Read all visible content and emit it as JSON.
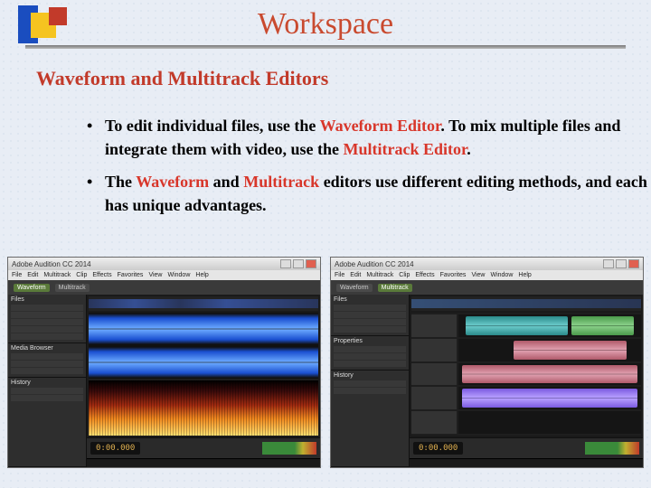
{
  "title": "Workspace",
  "subtitle": "Waveform and Multitrack Editors",
  "bullets": {
    "b1": {
      "pre": "To edit individual files, use the ",
      "em1": "Waveform Editor",
      "mid": ". To mix multiple files and integrate them with video, use the ",
      "em2": "Multitrack Editor",
      "post": "."
    },
    "b2": {
      "pre": "The ",
      "em1": "Waveform",
      "and": " and ",
      "em2": "Multitrack",
      "post": " editors use different editing methods, and each has unique advantages."
    }
  },
  "app": {
    "name": "Adobe Audition CC 2014",
    "menu": [
      "File",
      "Edit",
      "Multitrack",
      "Clip",
      "Effects",
      "Favorites",
      "View",
      "Window",
      "Help"
    ],
    "tabs": {
      "waveform": "Waveform",
      "multitrack": "Multitrack"
    },
    "timecode_left": "0:00.000",
    "timecode_right": "0:00.000",
    "panels": {
      "files": "Files",
      "media": "Media Browser",
      "history": "History",
      "properties": "Properties"
    }
  }
}
